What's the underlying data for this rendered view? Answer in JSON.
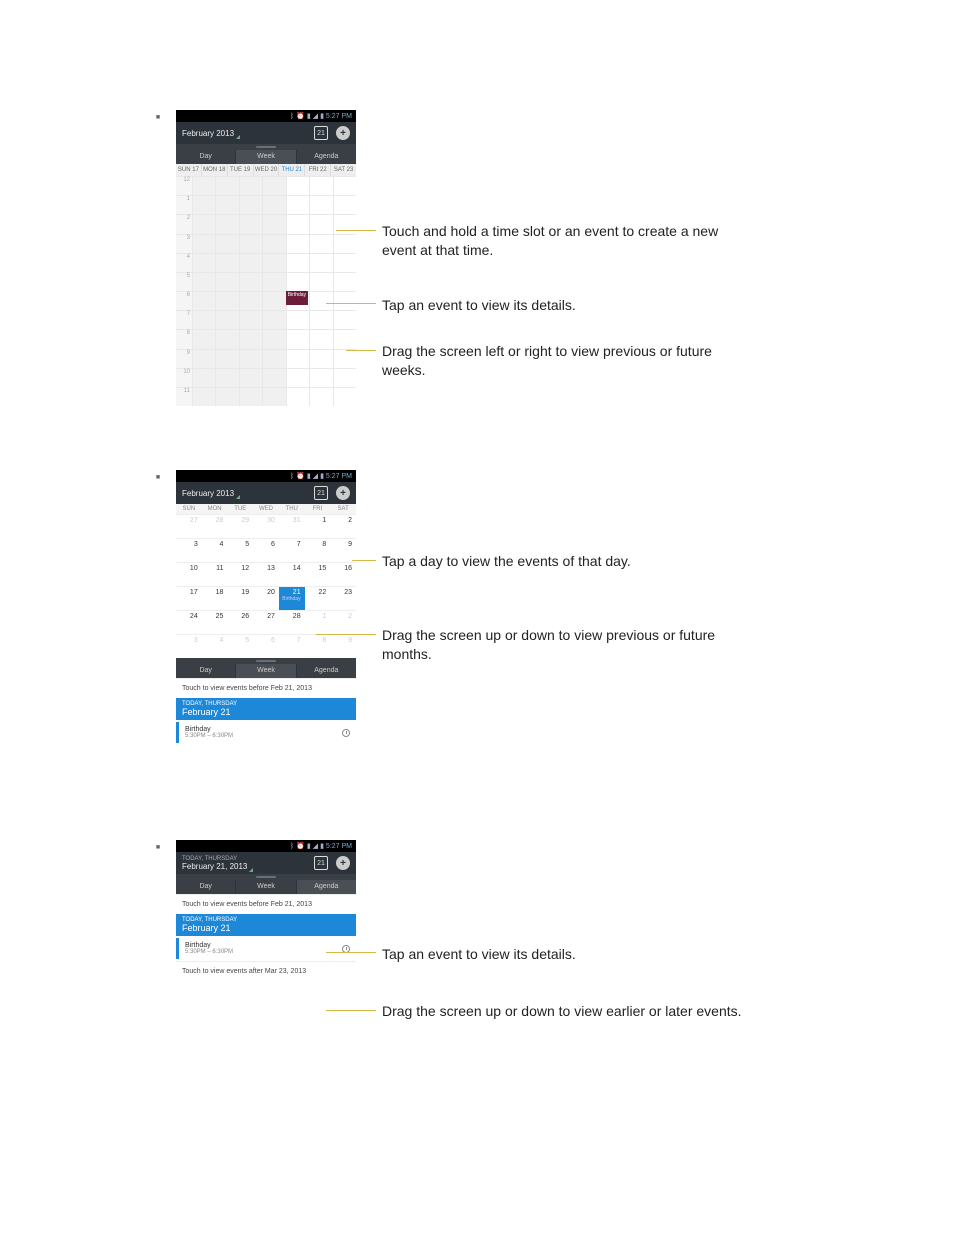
{
  "status": {
    "time": "5:27 PM"
  },
  "header": {
    "title": "February 2013",
    "title2": "February 21, 2013",
    "cal_day": "21"
  },
  "tabs": {
    "day": "Day",
    "week": "Week",
    "agenda": "Agenda"
  },
  "week": {
    "days": [
      "SUN 17",
      "MON 18",
      "TUE 19",
      "WED 20",
      "THU 21",
      "FRI 22",
      "SAT 23"
    ],
    "today_index": 4,
    "hours": [
      "12",
      "1",
      "2",
      "3",
      "4",
      "5",
      "6",
      "7",
      "8",
      "9",
      "10",
      "11"
    ],
    "event": {
      "label": "Birthday",
      "day_index": 4,
      "hour_index": 6
    }
  },
  "month": {
    "headers": [
      "SUN",
      "MON",
      "TUE",
      "WED",
      "THU",
      "FRI",
      "SAT"
    ],
    "rows": [
      [
        {
          "n": "27",
          "dim": true
        },
        {
          "n": "28",
          "dim": true
        },
        {
          "n": "29",
          "dim": true
        },
        {
          "n": "30",
          "dim": true
        },
        {
          "n": "31",
          "dim": true
        },
        {
          "n": "1"
        },
        {
          "n": "2"
        }
      ],
      [
        {
          "n": "3"
        },
        {
          "n": "4"
        },
        {
          "n": "5"
        },
        {
          "n": "6"
        },
        {
          "n": "7"
        },
        {
          "n": "8"
        },
        {
          "n": "9"
        }
      ],
      [
        {
          "n": "10"
        },
        {
          "n": "11"
        },
        {
          "n": "12"
        },
        {
          "n": "13"
        },
        {
          "n": "14"
        },
        {
          "n": "15"
        },
        {
          "n": "16"
        }
      ],
      [
        {
          "n": "17"
        },
        {
          "n": "18"
        },
        {
          "n": "19"
        },
        {
          "n": "20"
        },
        {
          "n": "21",
          "today": true,
          "sub": "Birthday"
        },
        {
          "n": "22"
        },
        {
          "n": "23"
        }
      ],
      [
        {
          "n": "24"
        },
        {
          "n": "25"
        },
        {
          "n": "26"
        },
        {
          "n": "27"
        },
        {
          "n": "28"
        },
        {
          "n": "1",
          "dim": true
        },
        {
          "n": "2",
          "dim": true
        }
      ],
      [
        {
          "n": "3",
          "dim": true
        },
        {
          "n": "4",
          "dim": true
        },
        {
          "n": "5",
          "dim": true
        },
        {
          "n": "6",
          "dim": true
        },
        {
          "n": "7",
          "dim": true
        },
        {
          "n": "8",
          "dim": true
        },
        {
          "n": "9",
          "dim": true
        }
      ]
    ]
  },
  "agenda": {
    "before": "Touch to view events before Feb 21, 2013",
    "after": "Touch to view events after Mar 23, 2013",
    "today_label": "TODAY, THURSDAY",
    "today_date": "February 21",
    "event_title": "Birthday",
    "event_time": "5:30PM – 6:30PM"
  },
  "callouts": {
    "week1": "Touch and hold a time slot or an event to create a new event at that time.",
    "week2": "Tap an event to view its details.",
    "week3": "Drag the screen left or right to view previous or future weeks.",
    "month1": "Tap a day to view the events of that day.",
    "month2": "Drag the screen up or down to view previous or future months.",
    "agenda1": "Tap an event to view its details.",
    "agenda2": "Drag the screen up or down to view earlier or later events."
  }
}
